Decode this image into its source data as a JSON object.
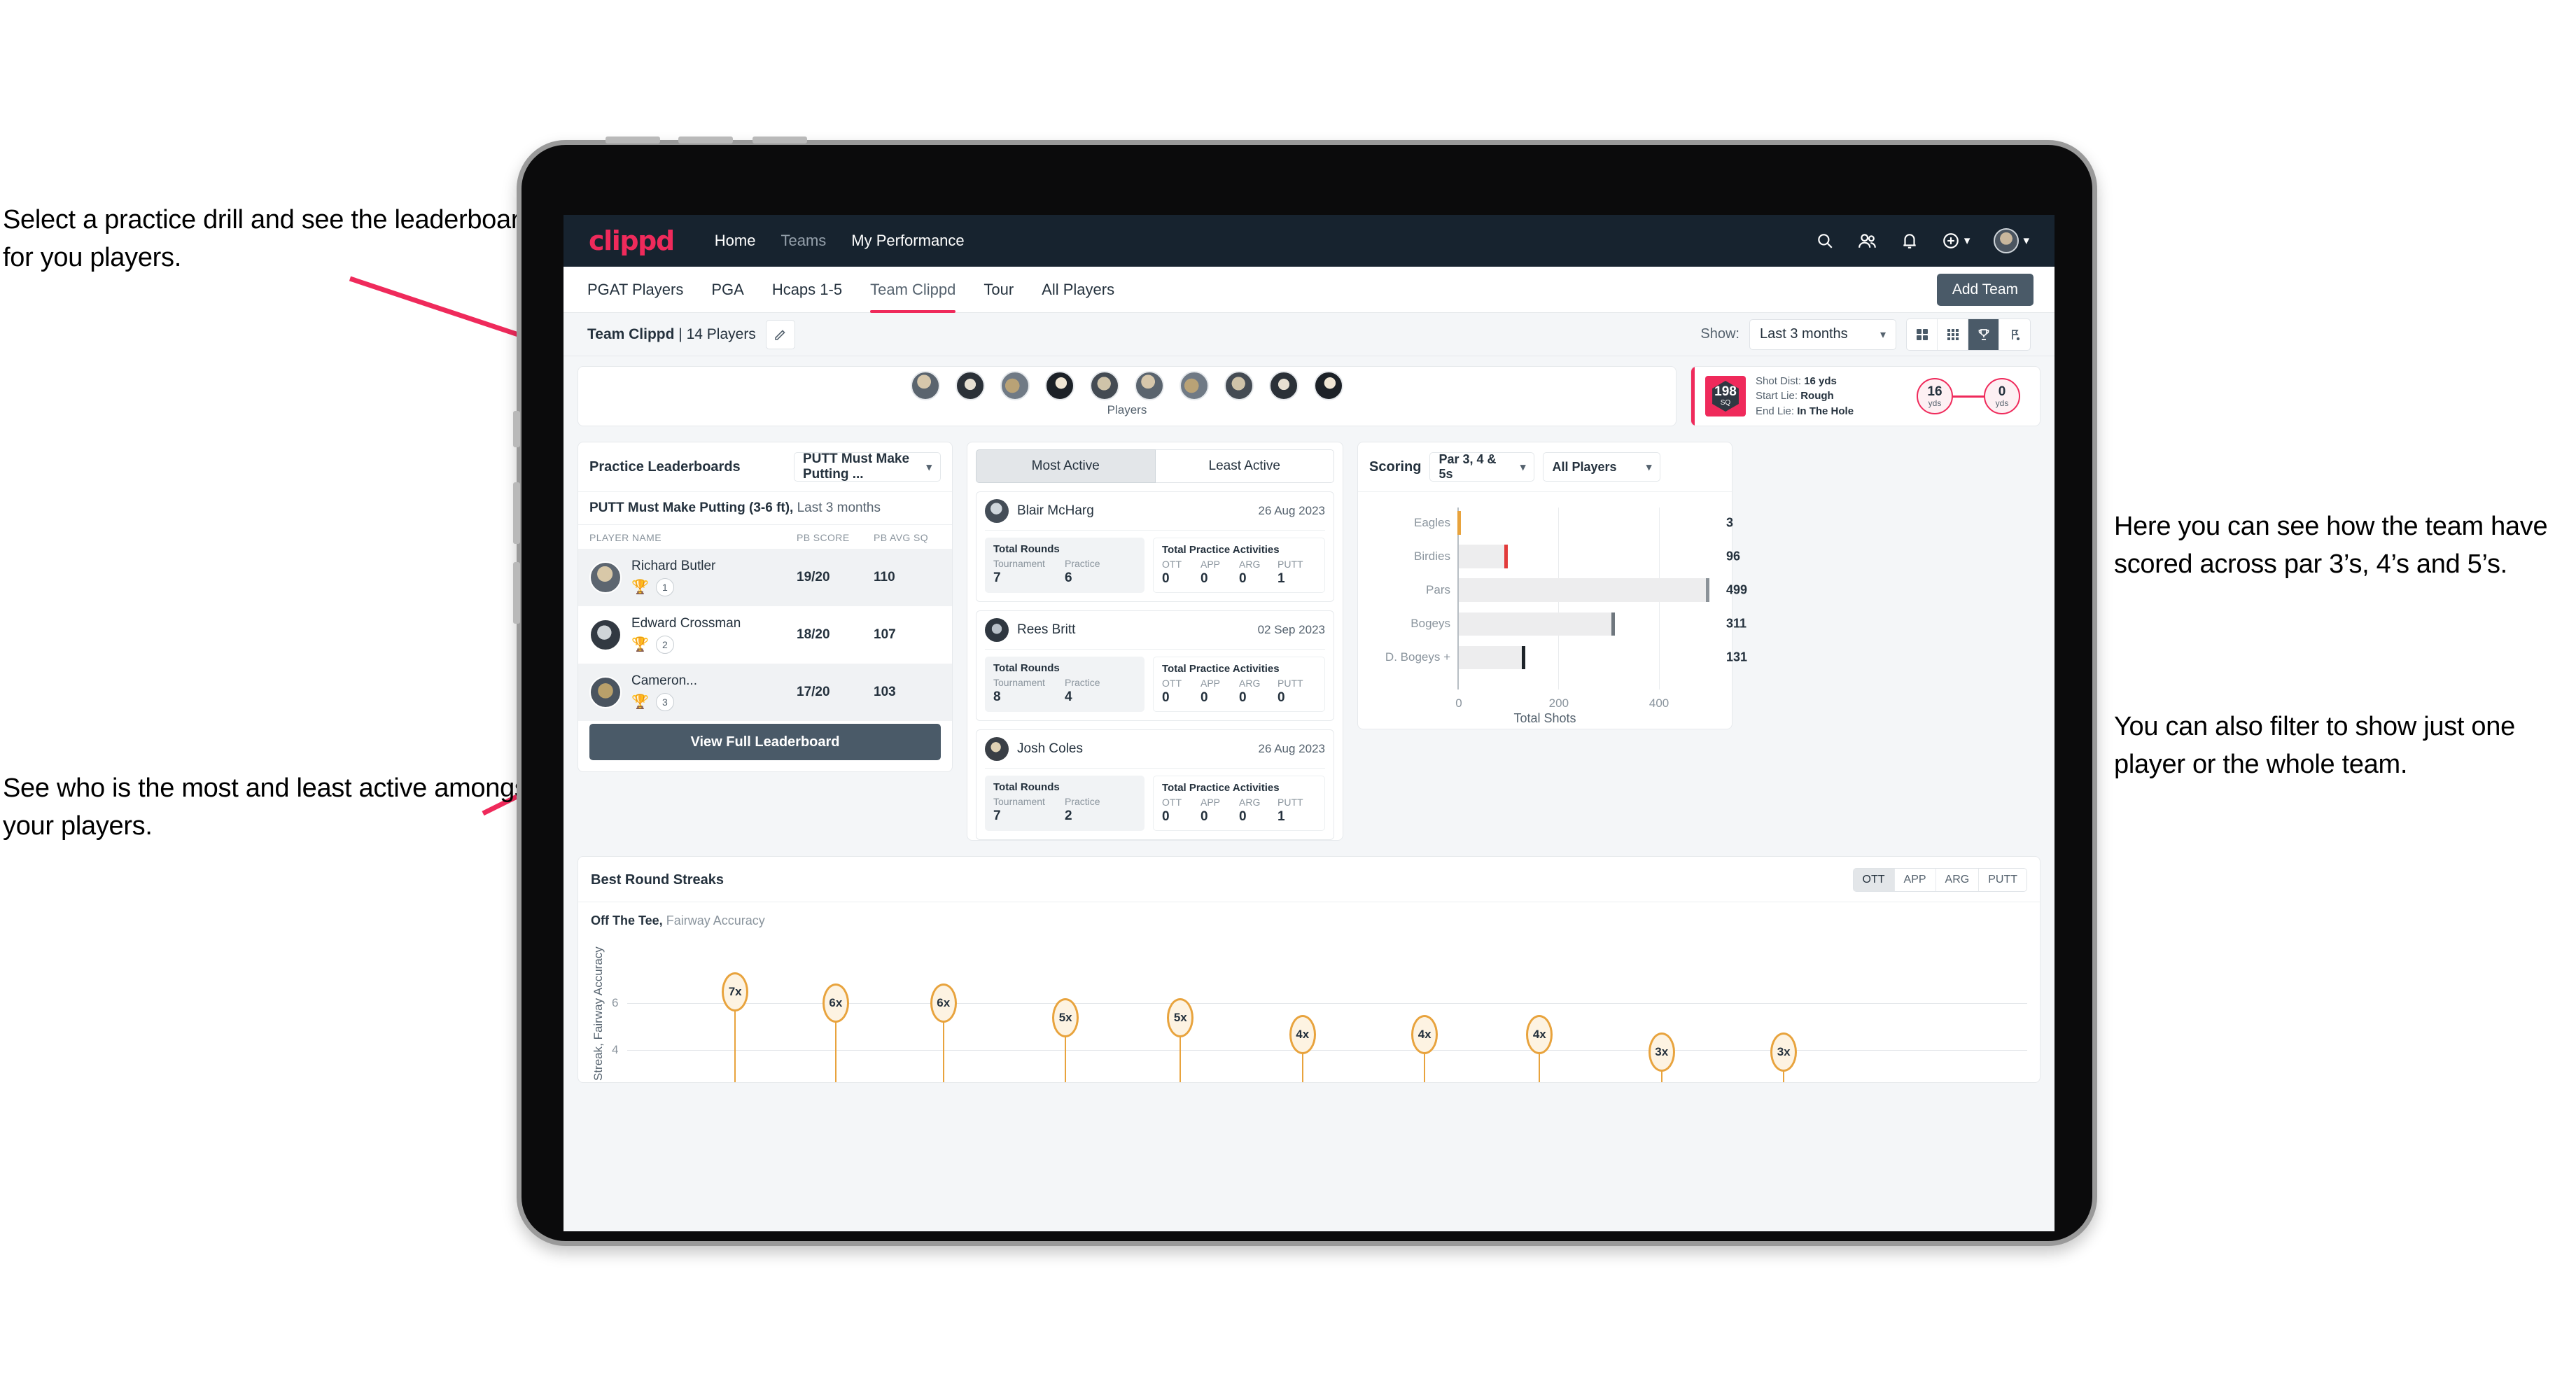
{
  "annotations": {
    "left_top": "Select a practice drill and see the leaderboard for you players.",
    "left_bottom": "See who is the most and least active amongst your players.",
    "right_top": "Here you can see how the team have scored across par 3’s, 4’s and 5’s.",
    "right_bottom": "You can also filter to show just one player or the whole team."
  },
  "colors": {
    "brand": "#ef2a5b",
    "nav_bg": "#17232f",
    "dark_button": "#4a5a68",
    "eagle": "#e8a33d",
    "birdie": "#e23b3b",
    "par": "#8b9298",
    "bogey": "#6f777e",
    "dbogey": "#1d2329"
  },
  "topnav": {
    "logo": "clippd",
    "links": [
      {
        "label": "Home",
        "active": true
      },
      {
        "label": "Teams",
        "active": false
      },
      {
        "label": "My Performance",
        "active": true
      }
    ],
    "icons": [
      "search-icon",
      "people-icon",
      "bell-icon",
      "plus-circle-icon",
      "avatar"
    ]
  },
  "tabs": {
    "items": [
      "PGAT Players",
      "PGA",
      "Hcaps 1-5",
      "Team Clippd",
      "Tour",
      "All Players"
    ],
    "active": "Team Clippd",
    "add_team_label": "Add Team"
  },
  "subheader": {
    "team_name": "Team Clippd",
    "player_count": "14 Players",
    "edit_icon": "pencil-icon",
    "show_label": "Show:",
    "range_value": "Last 3 months",
    "view_buttons": [
      "grid-large-icon",
      "grid-small-icon",
      "trophy-icon",
      "flag-icon"
    ],
    "active_view": "trophy-icon"
  },
  "players_strip": {
    "caption": "Players",
    "count": 10
  },
  "shot_card": {
    "sq_value": "198",
    "sq_unit": "SQ",
    "shot_dist_label": "Shot Dist:",
    "shot_dist_value": "16 yds",
    "start_lie_label": "Start Lie:",
    "start_lie_value": "Rough",
    "end_lie_label": "End Lie:",
    "end_lie_value": "In The Hole",
    "left_circle_value": "16",
    "left_circle_unit": "yds",
    "right_circle_value": "0",
    "right_circle_unit": "yds"
  },
  "leaderboard": {
    "title": "Practice Leaderboards",
    "drill_selected": "PUTT Must Make Putting ...",
    "subtitle_bold": "PUTT Must Make Putting (3-6 ft),",
    "subtitle_light": "Last 3 months",
    "columns": [
      "PLAYER NAME",
      "PB SCORE",
      "PB AVG SQ"
    ],
    "rows": [
      {
        "name": "Richard Butler",
        "rank": "1",
        "trophy": "gold",
        "pb_score": "19/20",
        "pb_avg_sq": "110"
      },
      {
        "name": "Edward Crossman",
        "rank": "2",
        "trophy": "silver",
        "pb_score": "18/20",
        "pb_avg_sq": "107"
      },
      {
        "name": "Cameron...",
        "rank": "3",
        "trophy": "bronze",
        "pb_score": "17/20",
        "pb_avg_sq": "103"
      }
    ],
    "view_full_label": "View Full Leaderboard"
  },
  "activity": {
    "tabs": [
      "Most Active",
      "Least Active"
    ],
    "active_tab": "Most Active",
    "rounds_header": "Total Rounds",
    "rounds_cols": [
      "Tournament",
      "Practice"
    ],
    "practice_header": "Total Practice Activities",
    "practice_cols": [
      "OTT",
      "APP",
      "ARG",
      "PUTT"
    ],
    "items": [
      {
        "name": "Blair McHarg",
        "date": "26 Aug 2023",
        "tournament": "7",
        "practice": "6",
        "ott": "0",
        "app": "0",
        "arg": "0",
        "putt": "1"
      },
      {
        "name": "Rees Britt",
        "date": "02 Sep 2023",
        "tournament": "8",
        "practice": "4",
        "ott": "0",
        "app": "0",
        "arg": "0",
        "putt": "0"
      },
      {
        "name": "Josh Coles",
        "date": "26 Aug 2023",
        "tournament": "7",
        "practice": "2",
        "ott": "0",
        "app": "0",
        "arg": "0",
        "putt": "1"
      }
    ]
  },
  "scoring": {
    "title": "Scoring",
    "par_filter": "Par 3, 4 & 5s",
    "player_filter": "All Players"
  },
  "streaks": {
    "title": "Best Round Streaks",
    "segments": [
      "OTT",
      "APP",
      "ARG",
      "PUTT"
    ],
    "active_segment": "OTT",
    "sub_bold": "Off The Tee,",
    "sub_light": "Fairway Accuracy"
  },
  "chart_data": [
    {
      "type": "bar",
      "orientation": "horizontal",
      "title": "Scoring",
      "categories": [
        "Eagles",
        "Birdies",
        "Pars",
        "Bogeys",
        "D. Bogeys +"
      ],
      "values": [
        3,
        96,
        499,
        311,
        131
      ],
      "colors": [
        "#e8a33d",
        "#e23b3b",
        "#8b9298",
        "#6f777e",
        "#1d2329"
      ],
      "xlabel": "Total Shots",
      "ylabel": "",
      "xlim": [
        0,
        520
      ],
      "xticks": [
        0,
        200,
        400
      ],
      "grid": true,
      "legend": false
    },
    {
      "type": "scatter",
      "subtype": "lollipop",
      "title": "Best Round Streaks",
      "subtitle": "Off The Tee, Fairway Accuracy",
      "ylabel": "Streak, Fairway Accuracy",
      "yticks": [
        4,
        6
      ],
      "ylim": [
        0,
        7.6
      ],
      "categories": [
        "1",
        "2",
        "3",
        "4",
        "5",
        "6",
        "7",
        "8",
        "9",
        "10"
      ],
      "values": [
        7,
        6,
        6,
        5,
        5,
        4,
        4,
        4,
        3,
        3
      ],
      "labels": [
        "7x",
        "6x",
        "6x",
        "5x",
        "5x",
        "4x",
        "4x",
        "4x",
        "3x",
        "3x"
      ],
      "marker_color": "#e8a33d",
      "grid": true,
      "legend": false
    }
  ]
}
